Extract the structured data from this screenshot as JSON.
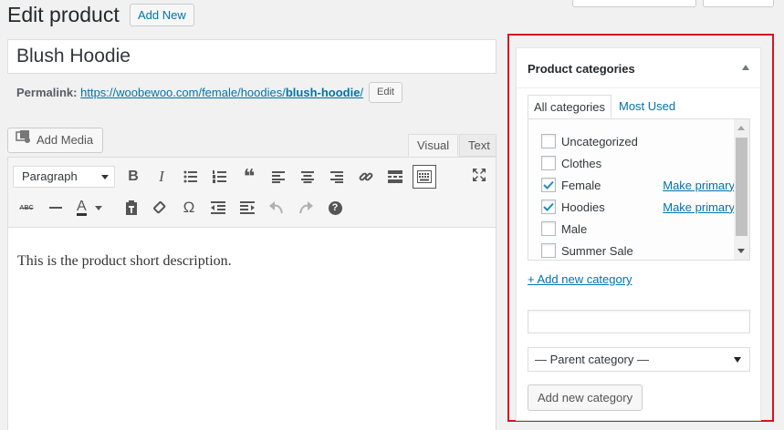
{
  "header": {
    "title": "Edit product",
    "add_new_label": "Add New"
  },
  "product": {
    "title": "Blush Hoodie"
  },
  "permalink": {
    "label": "Permalink:",
    "url_prefix": "https://woobewoo.com/female/hoodies/",
    "slug": "blush-hoodie",
    "url_suffix": "/",
    "edit_label": "Edit"
  },
  "editor": {
    "add_media_label": "Add Media",
    "tabs": {
      "visual": "Visual",
      "text": "Text"
    },
    "format_value": "Paragraph",
    "content": "This is the product short description.",
    "toolbar_row1_icons": [
      "bold-icon",
      "italic-icon",
      "bullet-list-icon",
      "numbered-list-icon",
      "blockquote-icon",
      "align-left-icon",
      "align-center-icon",
      "align-right-icon",
      "link-icon",
      "read-more-icon",
      "toolbar-toggle-icon",
      "fullscreen-icon"
    ],
    "toolbar_row2_icons": [
      "strikethrough-icon",
      "horizontal-line-icon",
      "text-color-icon",
      "paste-text-icon",
      "clear-formatting-icon",
      "special-character-icon",
      "outdent-icon",
      "indent-icon",
      "undo-icon",
      "redo-icon",
      "help-icon"
    ],
    "bold_glyph": "B",
    "italic_glyph": "I",
    "text_color_glyph": "A",
    "strikethrough_glyph": "ABC",
    "omega_glyph": "Ω",
    "quote_glyph": "❝",
    "help_glyph": "?"
  },
  "categories": {
    "title": "Product categories",
    "tabs": {
      "all": "All categories",
      "most_used": "Most Used"
    },
    "items": [
      {
        "label": "Uncategorized",
        "checked": false,
        "primary_link": ""
      },
      {
        "label": "Clothes",
        "checked": false,
        "primary_link": ""
      },
      {
        "label": "Female",
        "checked": true,
        "primary_link": "Make primary"
      },
      {
        "label": "Hoodies",
        "checked": true,
        "primary_link": "Make primary"
      },
      {
        "label": "Male",
        "checked": false,
        "primary_link": ""
      },
      {
        "label": "Summer Sale",
        "checked": false,
        "primary_link": ""
      }
    ],
    "add_new_link": "+ Add new category",
    "new_category_value": "",
    "parent_select_value": "— Parent category —",
    "add_button_label": "Add new category"
  },
  "colors": {
    "link": "#0073aa",
    "highlight": "#d5151f",
    "background": "#f1f1f1"
  }
}
